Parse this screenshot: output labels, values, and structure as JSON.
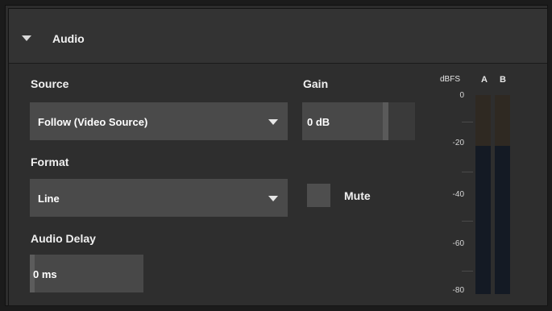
{
  "panel": {
    "title": "Audio"
  },
  "source": {
    "label": "Source",
    "value": "Follow (Video Source)"
  },
  "gain": {
    "label": "Gain",
    "value": "0 dB"
  },
  "format": {
    "label": "Format",
    "value": "Line"
  },
  "mute": {
    "label": "Mute",
    "checked": false
  },
  "audio_delay": {
    "label": "Audio Delay",
    "value": "0 ms"
  },
  "meter": {
    "unit": "dBFS",
    "channels": [
      "A",
      "B"
    ],
    "ticks": [
      "0",
      "-20",
      "-40",
      "-60",
      "-80"
    ],
    "level": {
      "A": null,
      "B": null
    }
  },
  "colors": {
    "background": "#2e2e2e",
    "field": "#4a4a4a",
    "meter_upper": "#2f2922",
    "meter_lower": "#141a24"
  }
}
